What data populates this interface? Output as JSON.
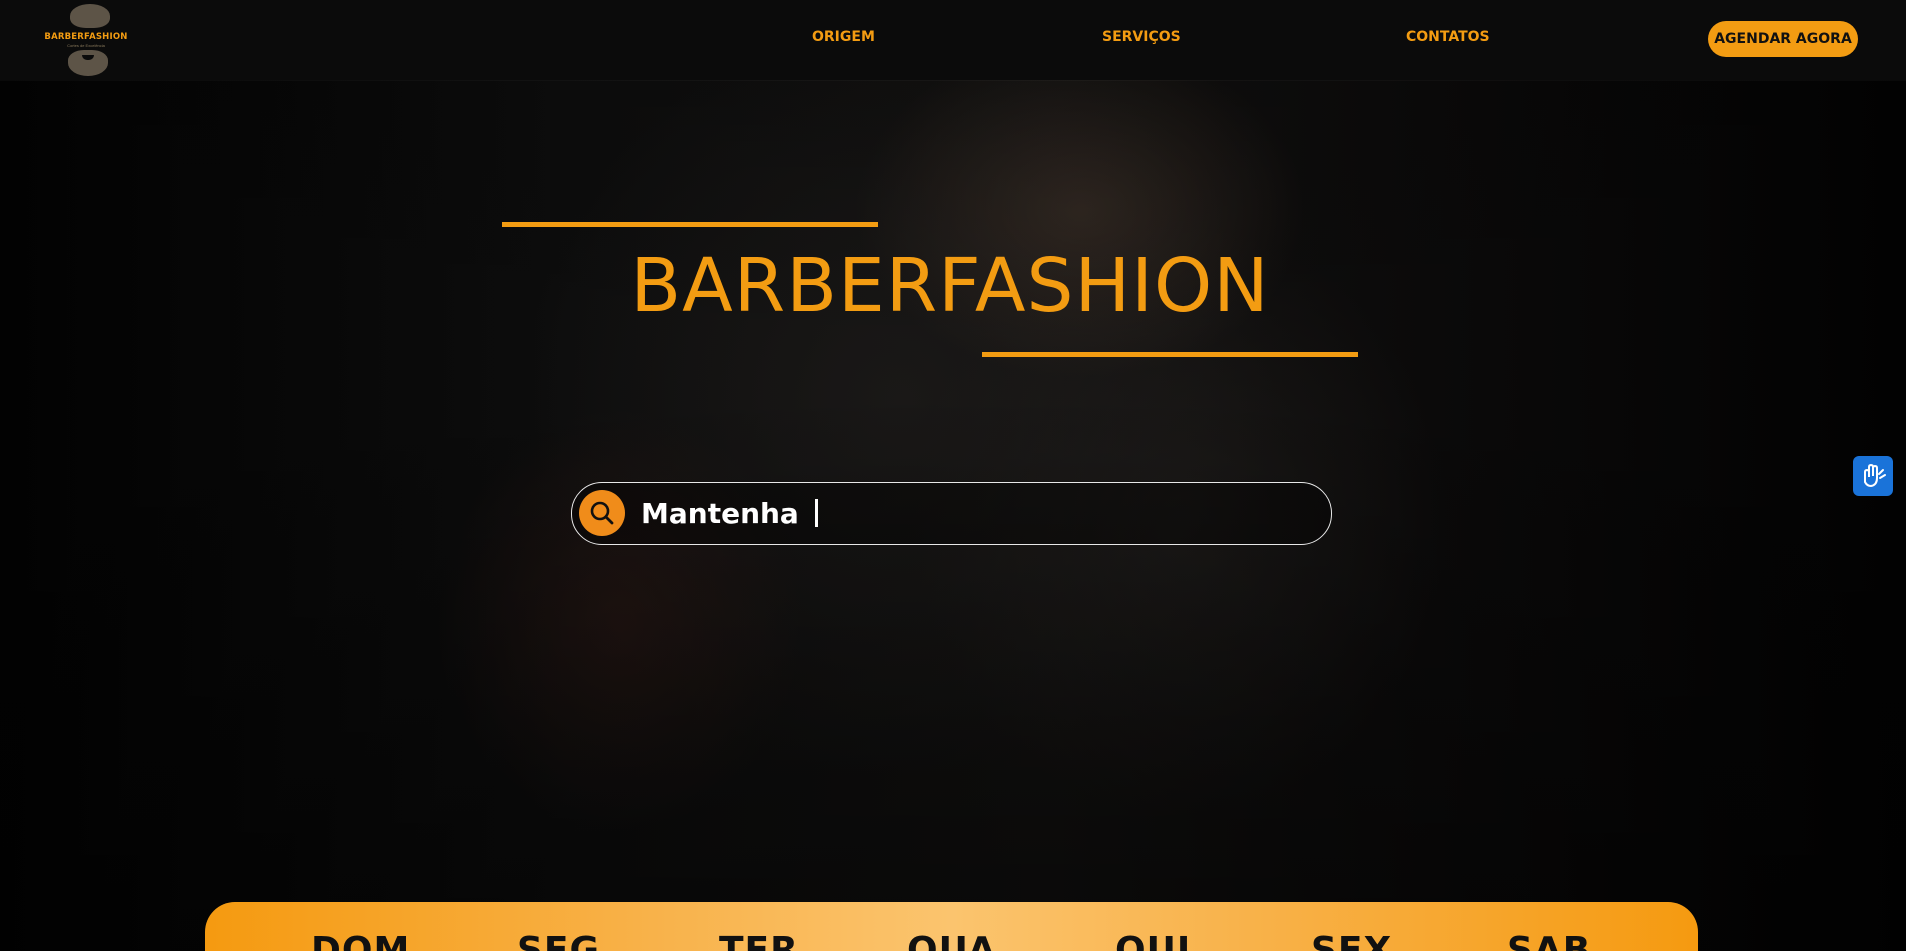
{
  "logo": {
    "name": "BARBERFASHION",
    "tagline": "Cortes de Excelência"
  },
  "nav": {
    "links": [
      "ORIGEM",
      "SERVIÇOS",
      "CONTATOS"
    ],
    "cta_label": "AGENDAR AGORA"
  },
  "hero": {
    "title": "BARBERFASHION"
  },
  "search": {
    "typed_text": "Mantenha",
    "icon": "search-icon"
  },
  "accessibility": {
    "icon": "sign-language-hands-icon"
  },
  "days": [
    "DOM",
    "SEG",
    "TER",
    "QUA",
    "QUI",
    "SEX",
    "SAB"
  ],
  "colors": {
    "accent": "#f39c12",
    "background": "#050505",
    "navbar": "#0b0b0b",
    "widget": "#1a73d9"
  }
}
